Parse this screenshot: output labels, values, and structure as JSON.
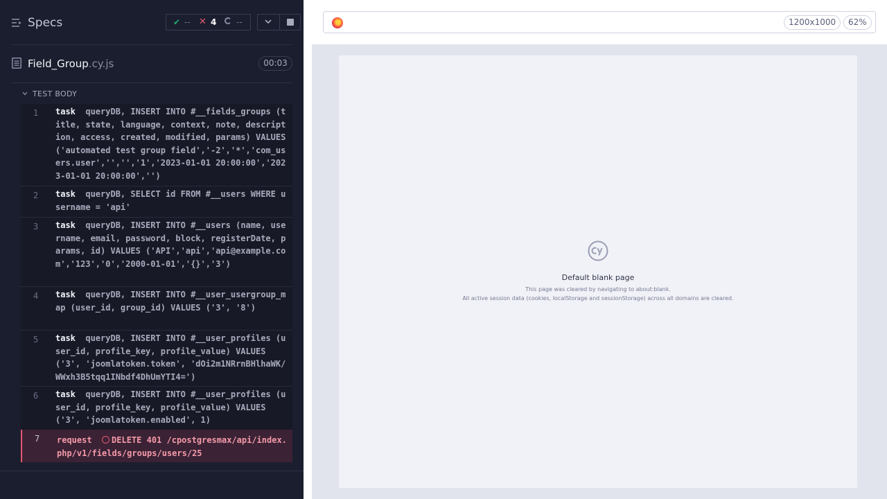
{
  "reporter": {
    "specs_title": "Specs",
    "stats": {
      "passed": "--",
      "failed": "4",
      "pending": "--"
    },
    "file": {
      "name": "Field_Group",
      "ext": ".cy.js",
      "duration": "00:03"
    },
    "section_label": "TEST BODY",
    "commands": [
      {
        "num": "1",
        "keyword": "task",
        "text": "queryDB, INSERT INTO #__fields_groups (title, state, language, context, note, description, access, created, modified, params) VALUES ('automated test group field','-2','*','com_users.user','','','1','2023-01-01 20:00:00','2023-01-01 20:00:00','')"
      },
      {
        "num": "2",
        "keyword": "task",
        "text": "queryDB, SELECT id FROM #__users WHERE username = 'api'"
      },
      {
        "num": "3",
        "keyword": "task",
        "text": "queryDB, INSERT INTO #__users (name, username, email, password, block, registerDate, params, id) VALUES ('API','api','api@example.com','123','0','2000-01-01','{}','3')"
      },
      {
        "num": "4",
        "keyword": "task",
        "text": "queryDB, INSERT INTO #__user_usergroup_map (user_id, group_id) VALUES ('3', '8')"
      },
      {
        "num": "5",
        "keyword": "task",
        "text": "queryDB, INSERT INTO #__user_profiles (user_id, profile_key, profile_value) VALUES ('3', 'joomlatoken.token', 'dOi2m1NRrnBHlhaWK/WWxh3B5tqq1INbdf4DhUmYTI4=')"
      },
      {
        "num": "6",
        "keyword": "task",
        "text": "queryDB, INSERT INTO #__user_profiles (user_id, profile_key, profile_value) VALUES ('3', 'joomlatoken.enabled', 1)"
      },
      {
        "num": "7",
        "keyword": "request",
        "text": "DELETE 401 /cpostgresmax/api/index.php/v1/fields/groups/users/25"
      }
    ]
  },
  "aut": {
    "viewport_size": "1200x1000",
    "zoom": "62%",
    "blank_title": "Default blank page",
    "blank_line1": "This page was cleared by navigating to about:blank.",
    "blank_line2": "All active session data (cookies, localStorage and sessionStorage) across all domains are cleared."
  },
  "colors": {
    "reporter_bg": "#1b1e2e",
    "pass": "#1fa971",
    "fail": "#e45770",
    "aut_bg": "#e1e3ed"
  }
}
